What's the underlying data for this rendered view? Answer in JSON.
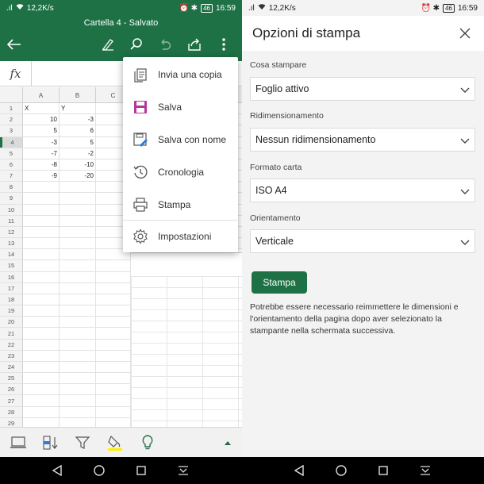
{
  "status": {
    "left_signal": ".ıl",
    "speed": "12,2K/s",
    "right_icons": "⏰ ✱",
    "battery": "46",
    "time": "16:59"
  },
  "excel": {
    "title": "Cartella 4 - Salvato",
    "fx_label": "fx",
    "columns": [
      "A",
      "B",
      "C"
    ],
    "row_numbers": [
      "1",
      "2",
      "3",
      "4",
      "5",
      "6",
      "7",
      "8",
      "9",
      "10",
      "11",
      "12",
      "13",
      "14",
      "15",
      "16",
      "17",
      "18",
      "19",
      "20",
      "21",
      "22",
      "23",
      "24",
      "25",
      "26",
      "27",
      "28",
      "29"
    ],
    "cells": [
      {
        "a": "X",
        "b": "Y"
      },
      {
        "a": "10",
        "b": "-3"
      },
      {
        "a": "5",
        "b": "6"
      },
      {
        "a": "-3",
        "b": "5"
      },
      {
        "a": "-7",
        "b": "-2"
      },
      {
        "a": "-8",
        "b": "-10"
      },
      {
        "a": "-9",
        "b": "-20"
      }
    ],
    "menu": [
      {
        "label": "Invia una copia",
        "icon": "document-copy-icon"
      },
      {
        "label": "Salva",
        "icon": "floppy-disk-icon"
      },
      {
        "label": "Salva con nome",
        "icon": "save-as-icon"
      },
      {
        "label": "Cronologia",
        "icon": "history-icon"
      },
      {
        "label": "Stampa",
        "icon": "printer-icon"
      },
      {
        "label": "Impostazioni",
        "icon": "gear-icon"
      }
    ],
    "colors": {
      "brand": "#1e7145",
      "save_icon": "#b4379b",
      "fill_highlight": "#ffef00",
      "bulb": "#1e7145"
    }
  },
  "print_options": {
    "title": "Opzioni di stampa",
    "fields": [
      {
        "label": "Cosa stampare",
        "value": "Foglio attivo"
      },
      {
        "label": "Ridimensionamento",
        "value": "Nessun ridimensionamento"
      },
      {
        "label": "Formato carta",
        "value": "ISO A4"
      },
      {
        "label": "Orientamento",
        "value": "Verticale"
      }
    ],
    "print_button": "Stampa",
    "note": "Potrebbe essere necessario reimmettere le dimensioni e l'orientamento della pagina dopo aver selezionato la stampante nella schermata successiva."
  }
}
